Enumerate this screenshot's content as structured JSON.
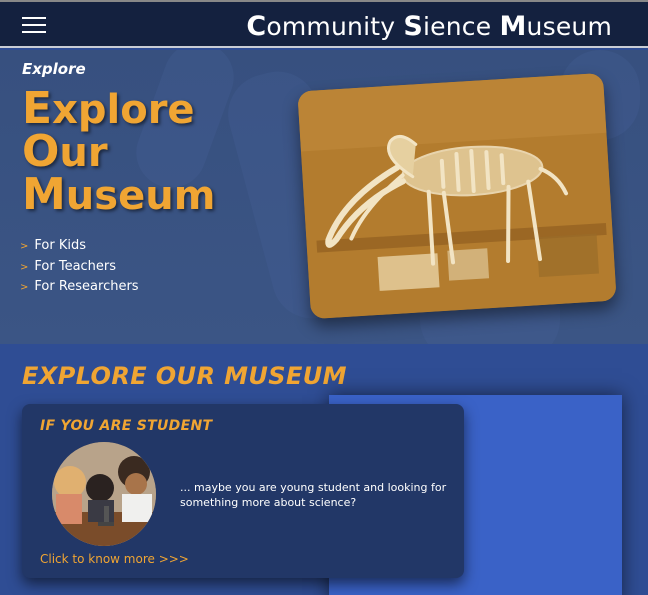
{
  "header": {
    "brand_parts": [
      {
        "cap": "C",
        "rest": "ommunity "
      },
      {
        "cap": "S",
        "rest": "ience "
      },
      {
        "cap": "M",
        "rest": "useum"
      }
    ]
  },
  "hero": {
    "label": "Explore",
    "title_lines": [
      {
        "cap": "E",
        "rest": "xplore"
      },
      {
        "cap": "O",
        "rest": "ur"
      },
      {
        "cap": "M",
        "rest": "useum"
      }
    ],
    "links": [
      "For Kids",
      "For Teachers",
      "For Researchers"
    ],
    "link_arrow": ">",
    "image_icon": "mammoth-skeleton-photo"
  },
  "section": {
    "title": "EXPLORE OUR MUSEUM"
  },
  "card": {
    "title": "IF YOU ARE STUDENT",
    "text": "... maybe you are young student and looking for something more about science?",
    "link": "Click to know more >>>",
    "image_icon": "students-microscope-photo"
  },
  "colors": {
    "accent": "#f0a533",
    "header_bg": "#14213f",
    "hero_bg": "#3b5585",
    "page_bg": "#2f4d94",
    "card_bg": "#223767",
    "block_blue": "#3a62c7"
  }
}
